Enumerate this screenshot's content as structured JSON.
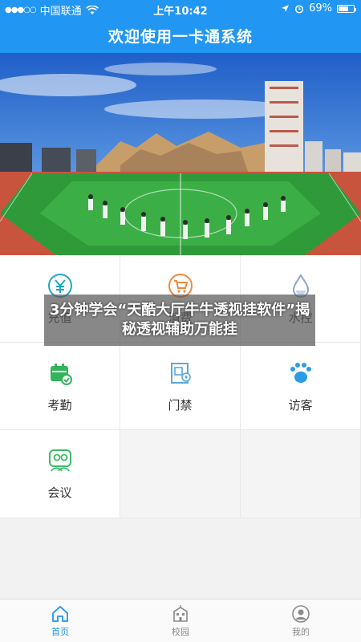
{
  "status_bar": {
    "carrier": "中国联通",
    "time": "上午10:42",
    "battery": "69%",
    "battery_level": 0.69
  },
  "header": {
    "title": "欢迎使用一卡通系统"
  },
  "banner": {
    "image": "campus-sports-field-photo"
  },
  "menu": [
    {
      "label": "充值",
      "icon": "yuan-icon",
      "color": "#1ea7c5"
    },
    {
      "label": "消费",
      "icon": "cart-icon",
      "color": "#f08a3c"
    },
    {
      "label": "水控",
      "icon": "water-drop-icon",
      "color": "#8fa4c8"
    },
    {
      "label": "考勤",
      "icon": "calendar-check-icon",
      "color": "#33b35a"
    },
    {
      "label": "门禁",
      "icon": "door-access-icon",
      "color": "#5aa9d6"
    },
    {
      "label": "访客",
      "icon": "footprint-icon",
      "color": "#2b9be6"
    },
    {
      "label": "会议",
      "icon": "meeting-icon",
      "color": "#3cba6a"
    }
  ],
  "overlay_text": "3分钟学会“天酷大厅牛牛透视挂软件”揭秘透视辅助万能挂",
  "tabs": [
    {
      "label": "首页",
      "icon": "home-icon",
      "active": true
    },
    {
      "label": "校园",
      "icon": "school-building-icon",
      "active": false
    },
    {
      "label": "我的",
      "icon": "user-icon",
      "active": false
    }
  ],
  "colors": {
    "primary": "#2196f3",
    "tab_inactive": "#8a8a8a"
  }
}
